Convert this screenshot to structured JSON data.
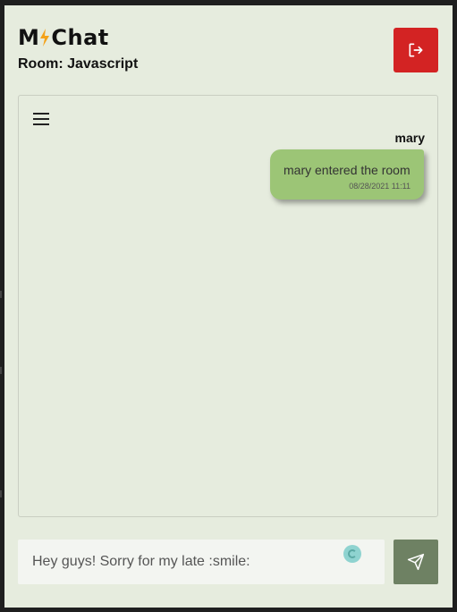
{
  "header": {
    "logo_text": "M Chat",
    "room_label": "Room: Javascript"
  },
  "icons": {
    "logout": "logout-icon",
    "menu": "hamburger-menu-icon",
    "emoji": "emoji-icon",
    "send": "send-icon"
  },
  "messages": [
    {
      "sender": "mary",
      "text": "mary entered the room",
      "timestamp": "08/28/2021 11:11"
    }
  ],
  "composer": {
    "value": "Hey guys! Sorry for my late :smile:"
  },
  "colors": {
    "background": "#e6ecde",
    "logout_button": "#d32323",
    "message_bubble": "#9cc576",
    "send_button": "#6e8163"
  }
}
